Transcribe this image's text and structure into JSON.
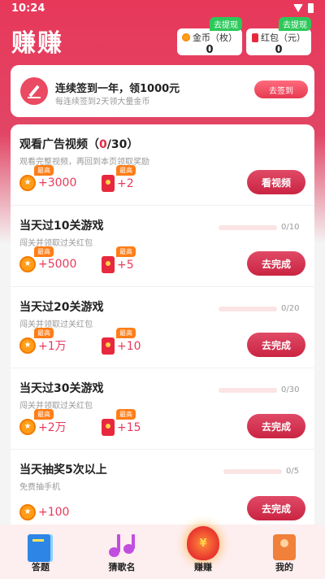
{
  "status": {
    "time": "10:24"
  },
  "app_title": "赚赚",
  "balances": {
    "coins": {
      "label": "金币（枚）",
      "value": "0",
      "tag": "去提现"
    },
    "redpack": {
      "label": "红包（元）",
      "value": "0",
      "tag": "去提现"
    }
  },
  "signin": {
    "title": "连续签到一年，领1000元",
    "subtitle": "每连续签到2天领大量金币",
    "button": "去签到"
  },
  "best_tag": "最高",
  "tasks": [
    {
      "title_prefix": "观看广告视频（",
      "title_hl": "0",
      "title_suffix": "/30）",
      "desc": "观看完整视频，再回到本页领取奖励",
      "coins": "+3000",
      "redpack": "+2",
      "button": "看视频"
    },
    {
      "title": "当天过10关游戏",
      "desc": "闯关并领取过关红包",
      "progress": "0/10",
      "progress_fraction": 0,
      "coins": "+5000",
      "redpack": "+5",
      "button": "去完成"
    },
    {
      "title": "当天过20关游戏",
      "desc": "闯关并领取过关红包",
      "progress": "0/20",
      "progress_fraction": 0,
      "coins": "+1万",
      "redpack": "+10",
      "button": "去完成"
    },
    {
      "title": "当天过30关游戏",
      "desc": "闯关并领取过关红包",
      "progress": "0/30",
      "progress_fraction": 0,
      "coins": "+2万",
      "redpack": "+15",
      "button": "去完成"
    },
    {
      "title": "当天抽奖5次以上",
      "desc": "免费抽手机",
      "progress": "0/5",
      "progress_fraction": 0,
      "coins": "+100",
      "button": "去完成"
    }
  ],
  "nav": [
    {
      "label": "答题",
      "icon": "book-icon"
    },
    {
      "label": "猜歌名",
      "icon": "music-note-icon"
    },
    {
      "label": "赚赚",
      "icon": "money-bag-icon",
      "active": true
    },
    {
      "label": "我的",
      "icon": "profile-icon"
    }
  ],
  "colors": {
    "primary": "#e7385a",
    "accent_green": "#2cc95a",
    "coin": "#ff9d17"
  }
}
